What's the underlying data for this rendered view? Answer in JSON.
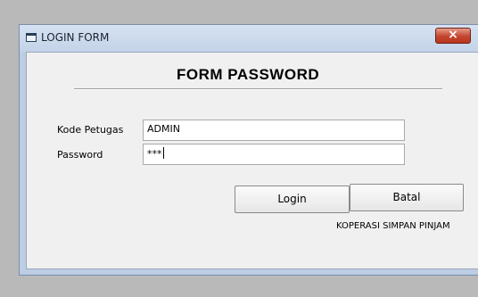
{
  "window": {
    "title": "LOGIN FORM",
    "title_icon": "window-icon",
    "close_icon": "close-icon",
    "close_symbol": "×"
  },
  "form": {
    "heading": "FORM PASSWORD",
    "kode_petugas_label": "Kode Petugas",
    "kode_petugas_value": "ADMIN",
    "password_label": "Password",
    "password_value": "***",
    "login_label": "Login",
    "batal_label": "Batal",
    "footer_text": "KOPERASI SIMPAN PINJAM"
  },
  "colors": {
    "close_button": "#c4442d",
    "title_bar": "#c3d3e8",
    "client_background": "#f0f0f0"
  }
}
